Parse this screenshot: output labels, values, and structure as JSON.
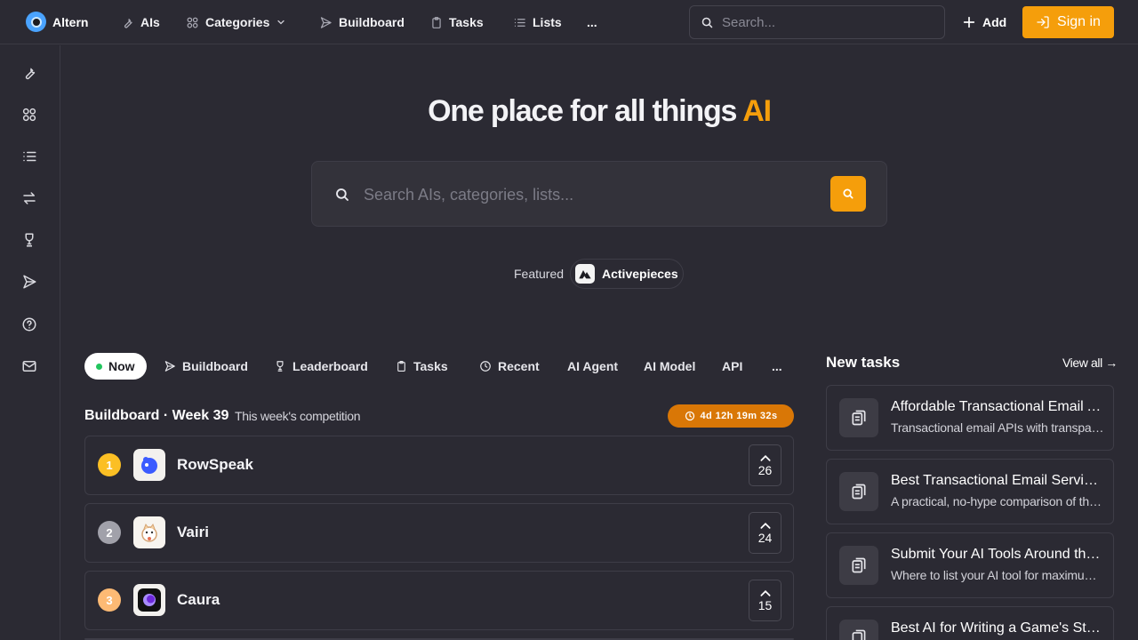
{
  "brand": {
    "name": "Altern"
  },
  "nav": [
    {
      "label": "AIs",
      "icon": "wrench-icon"
    },
    {
      "label": "Categories",
      "icon": "grid-icon"
    },
    {
      "label": "Buildboard",
      "icon": "send-icon"
    },
    {
      "label": "Tasks",
      "icon": "clipboard-icon"
    },
    {
      "label": "Lists",
      "icon": "list-icon"
    },
    {
      "label": "..."
    }
  ],
  "search": {
    "placeholder": "Search..."
  },
  "actions": {
    "add_label": "Add",
    "signin_label": "Sign in"
  },
  "hero": {
    "title_main": "One place for all things ",
    "title_accent": "AI",
    "search_placeholder": "Search AIs, categories, lists...",
    "featured_label": "Featured",
    "featured_name": "Activepieces"
  },
  "tabs": [
    {
      "label": "Now",
      "active": true
    },
    {
      "label": "Buildboard",
      "icon": "send-icon"
    },
    {
      "label": "Leaderboard",
      "icon": "trophy-icon"
    },
    {
      "label": "Tasks",
      "icon": "clipboard-icon"
    },
    {
      "label": "Recent",
      "icon": "clock-icon"
    },
    {
      "label": "AI Agent"
    },
    {
      "label": "AI Model"
    },
    {
      "label": "API"
    },
    {
      "label": "..."
    }
  ],
  "buildboard": {
    "title": "Buildboard · Week 39",
    "subtitle": "This week's competition",
    "timer": "4d 12h 19m 32s",
    "entries": [
      {
        "rank": "1",
        "name": "RowSpeak",
        "votes": "26"
      },
      {
        "rank": "2",
        "name": "Vairi",
        "votes": "24"
      },
      {
        "rank": "3",
        "name": "Caura",
        "votes": "15"
      }
    ]
  },
  "new_tasks": {
    "title": "New tasks",
    "view_all": "View all →",
    "items": [
      {
        "title": "Affordable Transactional Email APIs",
        "desc": "Transactional email APIs with transparent pricing"
      },
      {
        "title": "Best Transactional Email Services",
        "desc": "A practical, no-hype comparison of the best services"
      },
      {
        "title": "Submit Your AI Tools Around the Web",
        "desc": "Where to list your AI tool for maximum exposure"
      },
      {
        "title": "Best AI for Writing a Game's Story",
        "desc": ""
      }
    ]
  },
  "colors": {
    "accent": "#f59e0b",
    "background": "#2b2a33",
    "gold": "#fbbf24",
    "silver": "#a1a1aa",
    "bronze": "#fdba74"
  }
}
